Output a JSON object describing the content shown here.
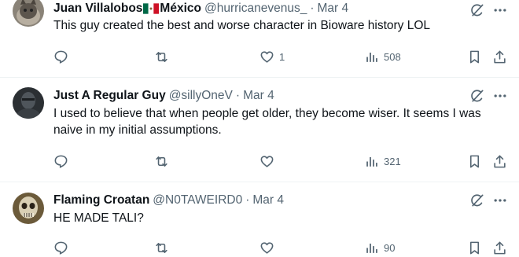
{
  "tweets": [
    {
      "name": "Juan Villalobos",
      "name_suffix": "México",
      "handle": "@hurricanevenus_",
      "dot": "·",
      "time": "Mar 4",
      "text": "This guy created the best and worse character in Bioware history LOL",
      "likes": "1",
      "views": "508",
      "avatar": "cat-avatar"
    },
    {
      "name": "Just A Regular Guy",
      "handle": "@sillyOneV",
      "dot": "·",
      "time": "Mar 4",
      "text": "I used to believe that when people get older, they become wiser. It seems I was naive in my initial assumptions.",
      "likes": "",
      "views": "321",
      "avatar": "dark-portrait-avatar"
    },
    {
      "name": "Flaming Croatan",
      "handle": "@N0TAWEIRD0",
      "dot": "·",
      "time": "Mar 4",
      "text": "HE MADE TALI?",
      "likes": "",
      "views": "90",
      "avatar": "skull-avatar"
    }
  ],
  "colors": {
    "text": "#0f1419",
    "secondary": "#536471",
    "divider": "#eff3f4"
  }
}
